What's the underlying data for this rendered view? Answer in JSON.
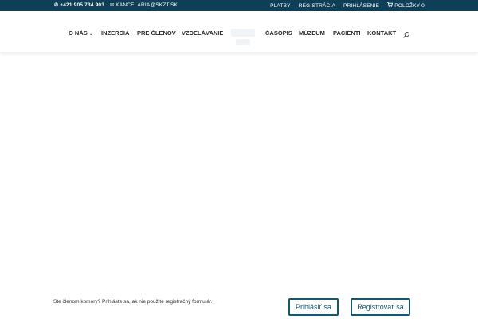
{
  "topbar": {
    "phone": "+421 905 734 903",
    "email": "KANCELARIA@SKZT.SK",
    "links": [
      "PLATBY",
      "REGISTRÁCIA",
      "PRIHLÁSENIE"
    ],
    "cart": "POLOŽKY 0",
    "phone_icon": "phone-icon",
    "email_icon": "envelope-icon",
    "cart_icon": "cart-icon"
  },
  "nav": {
    "items": [
      "O NÁS",
      "INZERCIA",
      "PRE ČLENOV",
      "VZDELÁVANIE",
      "ČASOPIS",
      "MÚZEUM",
      "PACIENTI",
      "KONTAKT"
    ],
    "search_icon": "search-icon",
    "dropdown_icon": "chevron-down-icon"
  },
  "cookie_bar": {
    "message": "Ste členom komory? Prihláste sa, ak nie použite registračný formulár.",
    "login_button": "Prihlásiť sa",
    "register_button": "Registrovať sa"
  },
  "colors": {
    "topbar_bg": "#0f3e57",
    "accent": "#14576f"
  }
}
